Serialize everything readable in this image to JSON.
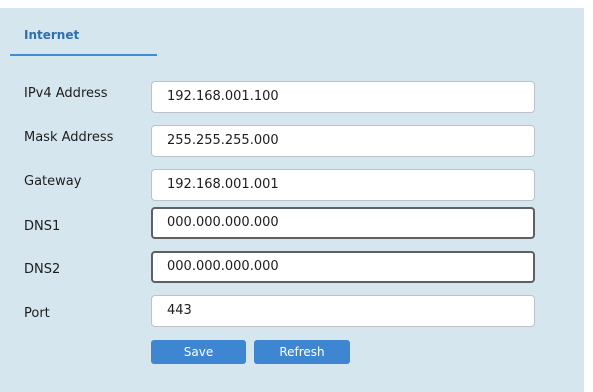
{
  "tab": {
    "label": "Internet"
  },
  "fields": [
    {
      "label": "IPv4 Address",
      "value": "192.168.001.100"
    },
    {
      "label": "Mask Address",
      "value": "255.255.255.000"
    },
    {
      "label": "Gateway",
      "value": "192.168.001.001"
    },
    {
      "label": "DNS1",
      "value": "000.000.000.000"
    },
    {
      "label": "DNS2",
      "value": "000.000.000.000"
    },
    {
      "label": "Port",
      "value": "443"
    }
  ],
  "buttons": {
    "save": "Save",
    "refresh": "Refresh"
  },
  "colors": {
    "panel_bg": "#d6e6ee",
    "accent": "#3f86d2",
    "tab_text": "#2c6fb3"
  }
}
